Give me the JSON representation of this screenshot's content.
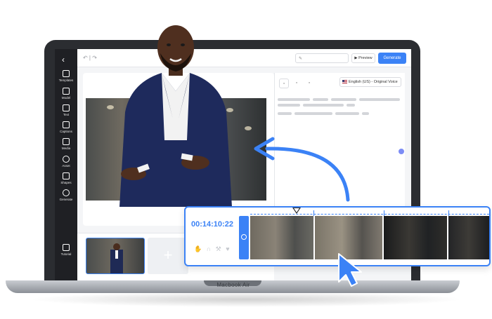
{
  "laptop": {
    "brand": "Macbook Air"
  },
  "sidebar": {
    "back_icon": "chevron-left-icon",
    "items": [
      {
        "label": "Templates",
        "icon": "templates-icon"
      },
      {
        "label": "Model",
        "icon": "model-icon"
      },
      {
        "label": "Text",
        "icon": "text-icon"
      },
      {
        "label": "Captions",
        "icon": "captions-icon"
      },
      {
        "label": "Media",
        "icon": "media-icon"
      },
      {
        "label": "Asset",
        "icon": "asset-icon"
      },
      {
        "label": "Shapes",
        "icon": "shapes-icon"
      },
      {
        "label": "Generate",
        "icon": "generate-icon"
      }
    ],
    "footer": {
      "label": "Tutorial",
      "icon": "tutorial-icon"
    }
  },
  "topbar": {
    "undo_redo": "↶ | ↷",
    "preview_label": "▶ Preview",
    "generate_label": "Generate"
  },
  "script_panel": {
    "language": "English (US) - Original Voice"
  },
  "timeline": {
    "timecode": "00:14:10:22",
    "controls_glyphs": "✋ ∩ ⚒ ♥"
  },
  "colors": {
    "accent": "#3b82f6",
    "sidebar": "#1f2024",
    "laptop_frame": "#2b2d31"
  }
}
